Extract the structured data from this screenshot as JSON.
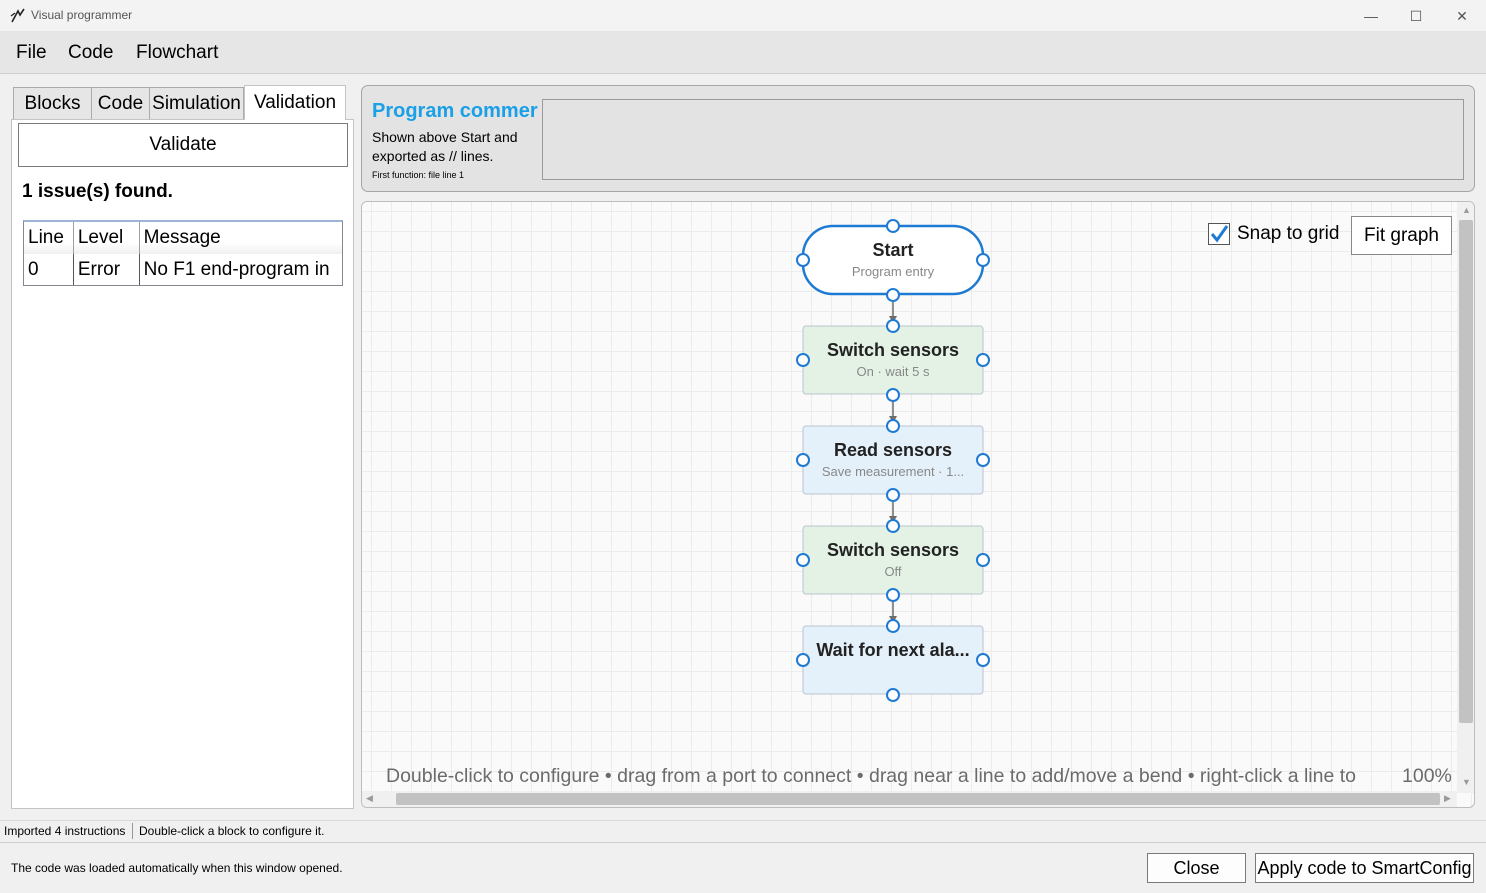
{
  "window": {
    "title": "Visual programmer",
    "minimize_glyph": "—",
    "maximize_glyph": "☐",
    "close_glyph": "✕"
  },
  "menu": [
    "File",
    "Code",
    "Flowchart"
  ],
  "left_panel": {
    "tabs": [
      "Blocks",
      "Code",
      "Simulation",
      "Validation"
    ],
    "active_tab": "Validation",
    "validate_label": "Validate",
    "issues_summary": "1 issue(s) found.",
    "table": {
      "headers": [
        "Line",
        "Level",
        "Message"
      ],
      "rows": [
        [
          "0",
          "Error",
          "No F1 end-program in"
        ]
      ]
    }
  },
  "header": {
    "program_comment_title": "Program commer",
    "description": "Shown above Start and exported as // lines.",
    "first_function": "First function: file line 1",
    "comment_value": ""
  },
  "canvas": {
    "snap_label": "Snap to grid",
    "snap_checked": true,
    "fit_label": "Fit graph",
    "hint": "Double-click to configure • drag from a port to connect • drag near a line to add/move a bend • right-click a line to",
    "zoom": "100%",
    "nodes": [
      {
        "title": "Start",
        "subtitle": "Program entry",
        "kind": "start"
      },
      {
        "title": "Switch sensors",
        "subtitle": "On · wait 5 s",
        "kind": "green"
      },
      {
        "title": "Read sensors",
        "subtitle": "Save measurement · 1...",
        "kind": "blue"
      },
      {
        "title": "Switch sensors",
        "subtitle": "Off",
        "kind": "green"
      },
      {
        "title": "Wait for next ala...",
        "subtitle": "",
        "kind": "blue"
      }
    ],
    "colors": {
      "accent": "#1e7ad2",
      "green_fill": "#e4f2e6",
      "blue_fill": "#e4f0fa",
      "node_border": "#b8c4cf",
      "connector": "#6d6d6d"
    }
  },
  "status": {
    "left": "Imported 4 instructions",
    "right": "Double-click a block to configure it."
  },
  "footer": {
    "message": "The code was loaded automatically when this window opened.",
    "close_label": "Close",
    "apply_label": "Apply code to SmartConfig"
  }
}
